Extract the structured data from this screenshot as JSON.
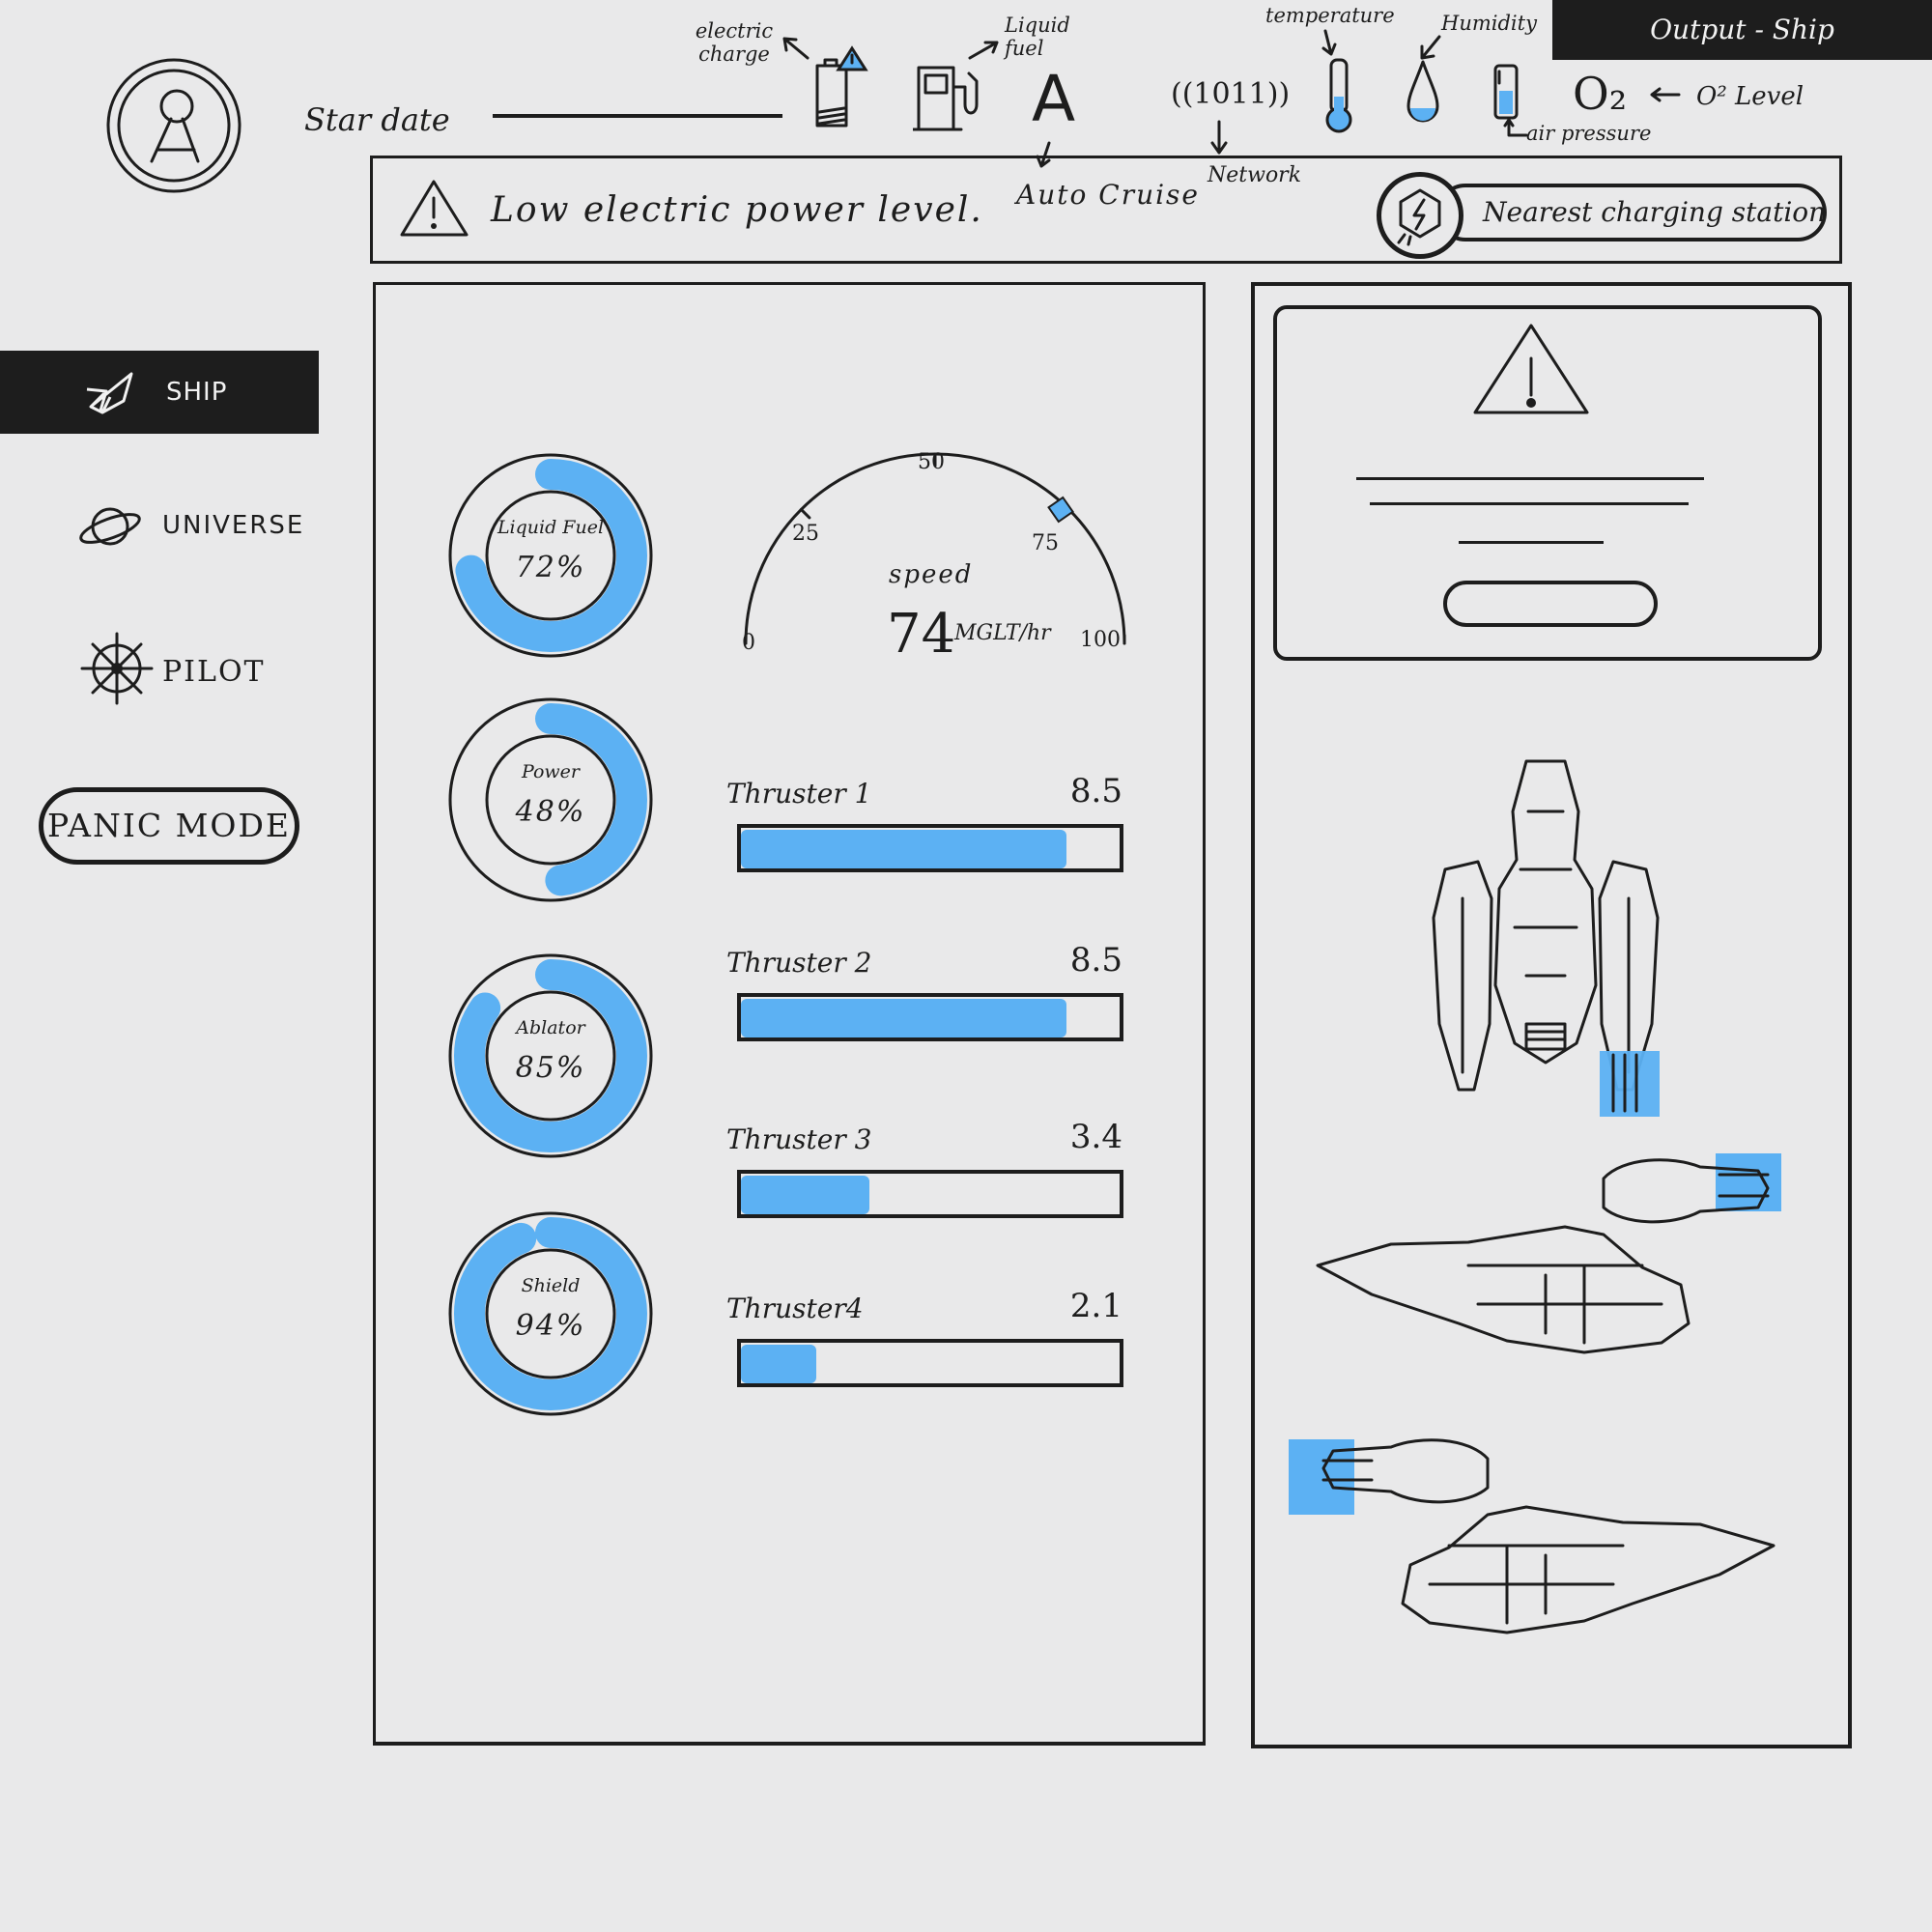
{
  "header": {
    "output_tag": "Output - Ship",
    "stardate_label": "Star date"
  },
  "status_icons": {
    "electric_charge": "electric charge",
    "liquid_fuel": "Liquid fuel",
    "auto_cruise_glyph": "A",
    "auto_cruise": "Auto Cruise",
    "network_glyph": "((1011))",
    "network": "Network",
    "temperature": "temperature",
    "humidity": "Humidity",
    "air_pressure": "air pressure",
    "o2_glyph": "O₂",
    "o2_level": "O² Level"
  },
  "alert": {
    "message": "Low electric power level.",
    "station_button": "Nearest charging station"
  },
  "sidebar": {
    "items": [
      {
        "label": "SHIP",
        "icon": "rocket-icon",
        "active": true
      },
      {
        "label": "UNIVERSE",
        "icon": "planet-icon",
        "active": false
      },
      {
        "label": "PILOT",
        "icon": "ship-wheel-icon",
        "active": false
      }
    ],
    "panic_button": "PANIC MODE"
  },
  "gauges": [
    {
      "name": "Liquid Fuel",
      "value_text": "72%",
      "value": 72
    },
    {
      "name": "Power",
      "value_text": "48%",
      "value": 48
    },
    {
      "name": "Ablator",
      "value_text": "85%",
      "value": 85
    },
    {
      "name": "Shield",
      "value_text": "94%",
      "value": 94
    }
  ],
  "speed": {
    "label": "speed",
    "value": "74",
    "unit": "MGLT/hr",
    "ticks": [
      "0",
      "25",
      "50",
      "75",
      "100"
    ],
    "level": 74
  },
  "thrusters": [
    {
      "name": "Thruster 1",
      "value": "8.5",
      "fill": 0.86
    },
    {
      "name": "Thruster 2",
      "value": "8.5",
      "fill": 0.86
    },
    {
      "name": "Thruster 3",
      "value": "3.4",
      "fill": 0.34
    },
    {
      "name": "Thruster4",
      "value": "2.1",
      "fill": 0.2
    }
  ],
  "colors": {
    "accent": "#5cb1f3",
    "ink": "#1d1d1d",
    "background": "#e9e9ea"
  }
}
